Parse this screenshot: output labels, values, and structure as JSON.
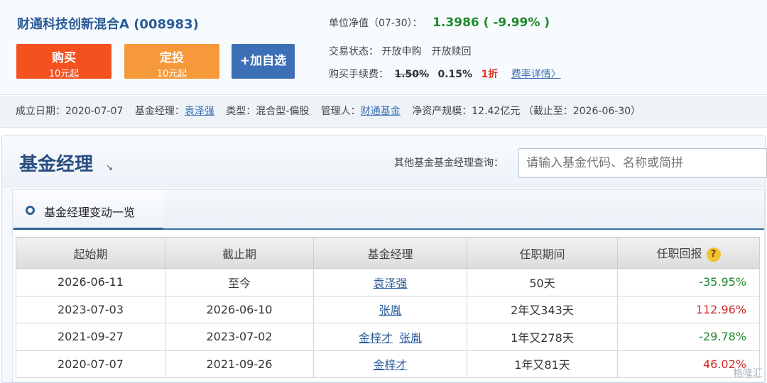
{
  "fund": {
    "title": "财通科技创新混合A (008983)",
    "buy": {
      "label": "购买",
      "sub": "10元起"
    },
    "fixed": {
      "label": "定投",
      "sub": "10元起"
    },
    "add": {
      "label": "+加自选"
    },
    "nav_label": "单位净值（07-30）：",
    "nav_value": "1.3986 ( -9.99% )",
    "trade_label": "交易状态：",
    "trade_status": "开放申购　开放赎回",
    "fee_label": "购买手续费：",
    "fee_old": "1.50%",
    "fee_new": "0.15%",
    "fee_discount": "1折",
    "fee_link": "费率详情〉"
  },
  "meta": {
    "established_label": "成立日期：",
    "established": "2020-07-07",
    "manager_label": "基金经理：",
    "manager": "袁泽强",
    "type_label": "类型：",
    "type": "混合型-偏股",
    "admin_label": "管理人：",
    "admin": "财通基金",
    "size_label": "净资产规模：",
    "size": "12.42亿元 （截止至：2026-06-30）"
  },
  "panel": {
    "title": "基金经理",
    "arrow": "↘",
    "query_label": "其他基金基金经理查询：",
    "query_placeholder": "请输入基金代码、名称或简拼",
    "tab": "基金经理变动一览"
  },
  "table": {
    "headers": [
      "起始期",
      "截止期",
      "基金经理",
      "任职期间",
      "任职回报"
    ],
    "help": "?",
    "rows": [
      {
        "start": "2026-06-11",
        "end": "至今",
        "m1": "袁泽强",
        "m2": "",
        "period": "50天",
        "ret": "-35.95%",
        "ret_sign": "neg"
      },
      {
        "start": "2023-07-03",
        "end": "2026-06-10",
        "m1": "张胤",
        "m2": "",
        "period": "2年又343天",
        "ret": "112.96%",
        "ret_sign": "pos"
      },
      {
        "start": "2021-09-27",
        "end": "2023-07-02",
        "m1": "金梓才",
        "m2": "张胤",
        "period": "1年又278天",
        "ret": "-29.78%",
        "ret_sign": "neg"
      },
      {
        "start": "2020-07-07",
        "end": "2021-09-26",
        "m1": "金梓才",
        "m2": "",
        "period": "1年又81天",
        "ret": "46.02%",
        "ret_sign": "pos"
      }
    ]
  },
  "watermark": "格隆汇"
}
